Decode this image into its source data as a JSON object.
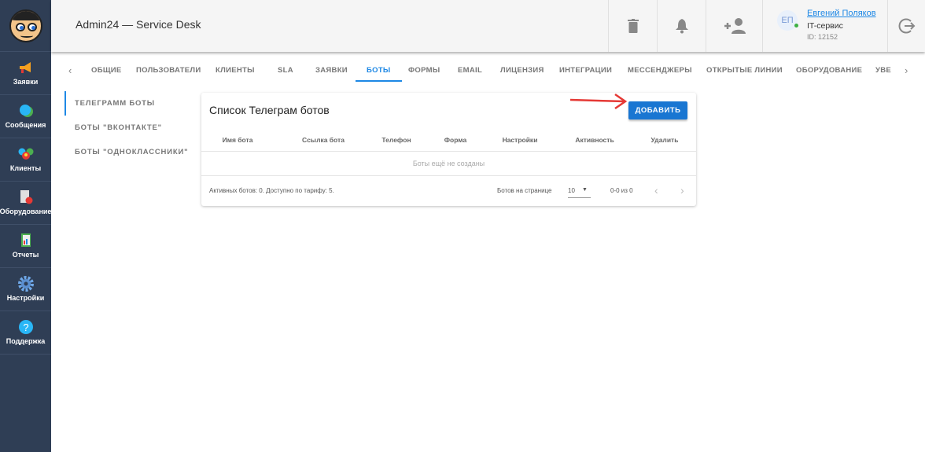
{
  "sidebar": {
    "items": [
      {
        "label": "Заявки",
        "icon": "megaphone-icon"
      },
      {
        "label": "Сообщения",
        "icon": "chat-icon"
      },
      {
        "label": "Клиенты",
        "icon": "clients-icon"
      },
      {
        "label": "Оборудование",
        "icon": "equipment-icon"
      },
      {
        "label": "Отчеты",
        "icon": "reports-icon"
      },
      {
        "label": "Настройки",
        "icon": "gear-icon"
      },
      {
        "label": "Поддержка",
        "icon": "help-icon"
      }
    ]
  },
  "header": {
    "title": "Admin24 — Service Desk",
    "user": {
      "initials": "ЕП",
      "name": "Евгений Поляков",
      "org": "IT-сервис",
      "id": "ID: 12152"
    }
  },
  "tabs": [
    "ОБЩИЕ",
    "ПОЛЬЗОВАТЕЛИ",
    "КЛИЕНТЫ",
    "SLA",
    "ЗАЯВКИ",
    "БОТЫ",
    "ФОРМЫ",
    "EMAIL",
    "ЛИЦЕНЗИЯ",
    "ИНТЕГРАЦИИ",
    "МЕССЕНДЖЕРЫ",
    "ОТКРЫТЫЕ ЛИНИИ",
    "ОБОРУДОВАНИЕ",
    "УВЕ"
  ],
  "active_tab": "БОТЫ",
  "subtabs": [
    "ТЕЛЕГРАММ БОТЫ",
    "БОТЫ \"ВКОНТАКТЕ\"",
    "БОТЫ \"ОДНОКЛАССНИКИ\""
  ],
  "card": {
    "title": "Список Телеграм ботов",
    "add_label": "ДОБАВИТЬ",
    "columns": [
      "Имя бота",
      "Ссылка бота",
      "Телефон",
      "Форма",
      "Настройки",
      "Активность",
      "Удалить"
    ],
    "empty": "Боты ещё не созданы",
    "footer": {
      "summary": "Активных ботов: 0. Доступно по тарифу: 5.",
      "per_page_label": "Ботов на странице",
      "per_page": "10",
      "range": "0-0 из 0"
    }
  },
  "colors": {
    "sidebar": "#2f3e55",
    "accent": "#1976d2",
    "annotation": "#e53935"
  }
}
